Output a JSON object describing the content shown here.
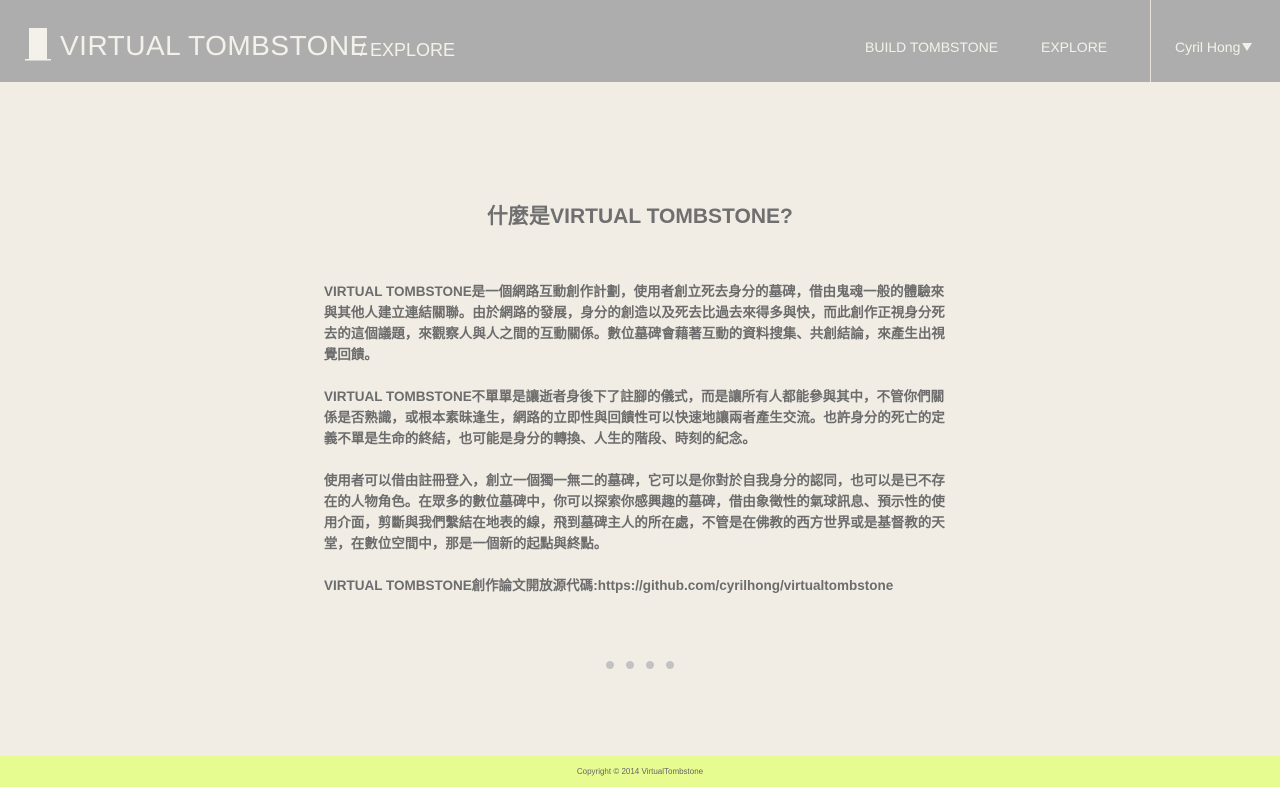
{
  "header": {
    "title": "VIRTUAL TOMBSTONE",
    "subtitle": "/ EXPLORE",
    "nav": {
      "build_label": "BUILD TOMBSTONE",
      "explore_label": "EXPLORE"
    },
    "user": {
      "name": "Cyril Hong"
    }
  },
  "main": {
    "heading": "什麼是VIRTUAL TOMBSTONE?",
    "paragraphs": [
      "VIRTUAL TOMBSTONE是一個網路互動創作計劃，使用者創立死去身分的墓碑，借由鬼魂一般的體驗來與其他人建立連結關聯。由於網路的發展，身分的創造以及死去比過去來得多與快，而此創作正視身分死去的這個議題，來觀察人與人之間的互動關係。數位墓碑會藉著互動的資料搜集、共創結論，來產生出視覺回饋。",
      "VIRTUAL TOMBSTONE不單單是讓逝者身後下了註腳的儀式，而是讓所有人都能參與其中，不管你們關係是否熟識，或根本素昧逢生，網路的立即性與回饋性可以快速地讓兩者產生交流。也許身分的死亡的定義不單是生命的終結，也可能是身分的轉換、人生的階段、時刻的紀念。",
      "使用者可以借由註冊登入，創立一個獨一無二的墓碑，它可以是你對於自我身分的認同，也可以是已不存在的人物角色。在眾多的數位墓碑中，你可以探索你感興趣的墓碑，借由象徵性的氣球訊息、預示性的使用介面，剪斷與我們繫結在地表的線，飛到墓碑主人的所在處，不管是在佛教的西方世界或是基督教的天堂，在數位空間中，那是一個新的起點與終點。",
      "VIRTUAL TOMBSTONE創作論文開放源代碼:https://github.com/cyrilhong/virtualtombstone"
    ]
  },
  "carousel": {
    "dot_count": 4
  },
  "footer": {
    "copyright": "Copyright © 2014 VirtualTombstone"
  },
  "colors": {
    "header_bg": "#adadad",
    "page_bg": "#f1ede5",
    "footer_bg": "#e6fb90",
    "text_muted": "#6c6c6c"
  },
  "icons": {
    "logo": "tombstone-logo-icon",
    "user_menu": "caret-down-icon"
  }
}
